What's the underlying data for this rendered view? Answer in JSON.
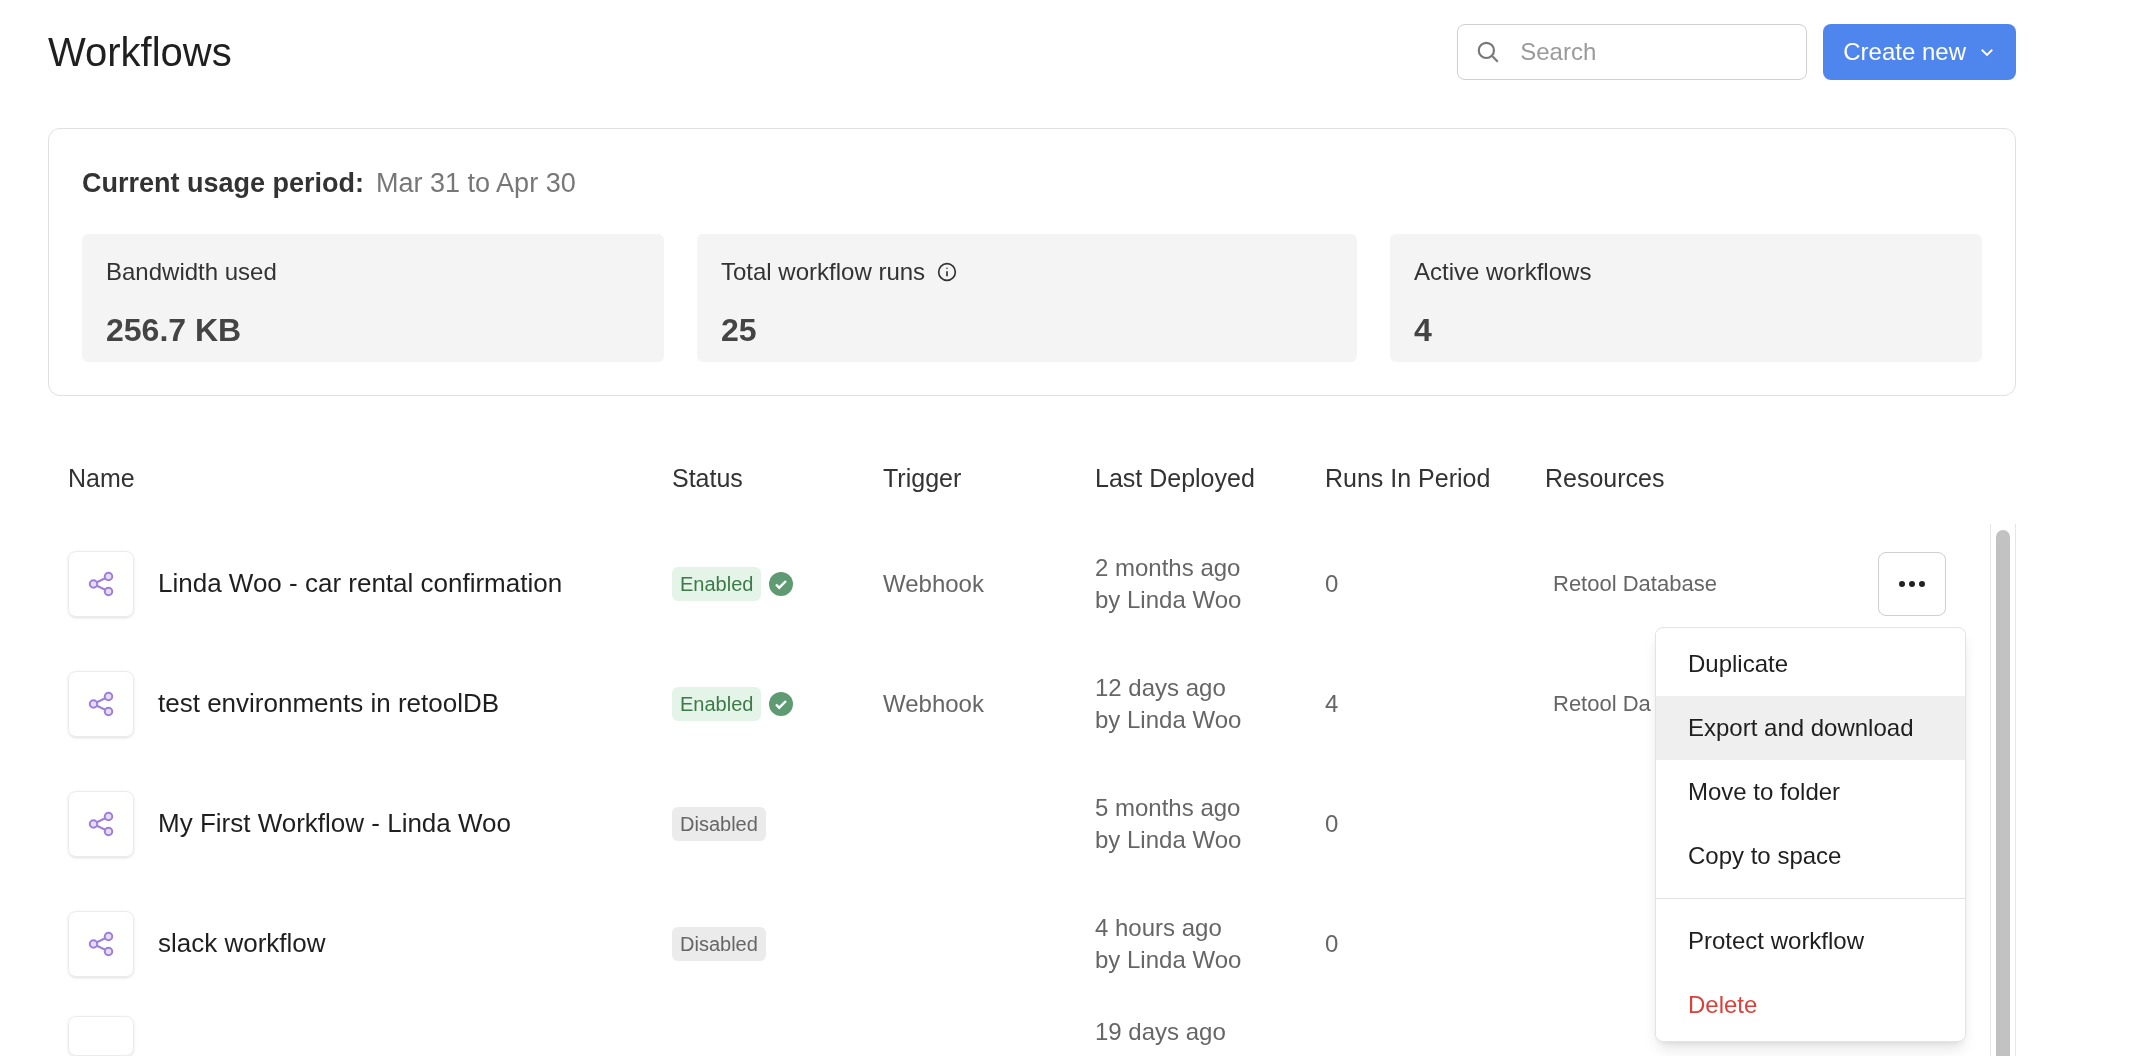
{
  "header": {
    "title": "Workflows",
    "search": {
      "placeholder": "Search"
    },
    "create_button": "Create new"
  },
  "usage": {
    "label": "Current usage period:",
    "period": "Mar 31 to Apr 30",
    "stats": [
      {
        "label": "Bandwidth used",
        "value": "256.7 KB",
        "info": false
      },
      {
        "label": "Total workflow runs",
        "value": "25",
        "info": true
      },
      {
        "label": "Active workflows",
        "value": "4",
        "info": false
      }
    ]
  },
  "table": {
    "columns": [
      "Name",
      "Status",
      "Trigger",
      "Last Deployed",
      "Runs In Period",
      "Resources"
    ],
    "rows": [
      {
        "name": "Linda Woo - car rental confirmation",
        "status": {
          "label": "Enabled",
          "kind": "enabled"
        },
        "trigger": "Webhook",
        "last_deployed": "2 months ago",
        "deployed_by": "by Linda Woo",
        "runs": "0",
        "resources": "Retool Database",
        "menu_open": true
      },
      {
        "name": "test environments in retoolDB",
        "status": {
          "label": "Enabled",
          "kind": "enabled"
        },
        "trigger": "Webhook",
        "last_deployed": "12 days ago",
        "deployed_by": "by Linda Woo",
        "runs": "4",
        "resources": "Retool Da"
      },
      {
        "name": "My First Workflow - Linda Woo",
        "status": {
          "label": "Disabled",
          "kind": "disabled"
        },
        "last_deployed": "5 months ago",
        "deployed_by": "by Linda Woo",
        "runs": "0"
      },
      {
        "name": "slack workflow",
        "status": {
          "label": "Disabled",
          "kind": "disabled"
        },
        "last_deployed": "4 hours ago",
        "deployed_by": "by Linda Woo",
        "runs": "0"
      },
      {
        "last_deployed": "19 days ago"
      }
    ]
  },
  "menu": {
    "items": [
      {
        "label": "Duplicate",
        "kind": "normal",
        "highlighted": false
      },
      {
        "label": "Export and download",
        "kind": "normal",
        "highlighted": true
      },
      {
        "label": "Move to folder",
        "kind": "normal",
        "highlighted": false
      },
      {
        "label": "Copy to space",
        "kind": "normal",
        "highlighted": false
      },
      {
        "label": "Protect workflow",
        "kind": "normal",
        "highlighted": false,
        "divider_before": true
      },
      {
        "label": "Delete",
        "kind": "danger",
        "highlighted": false
      }
    ]
  }
}
